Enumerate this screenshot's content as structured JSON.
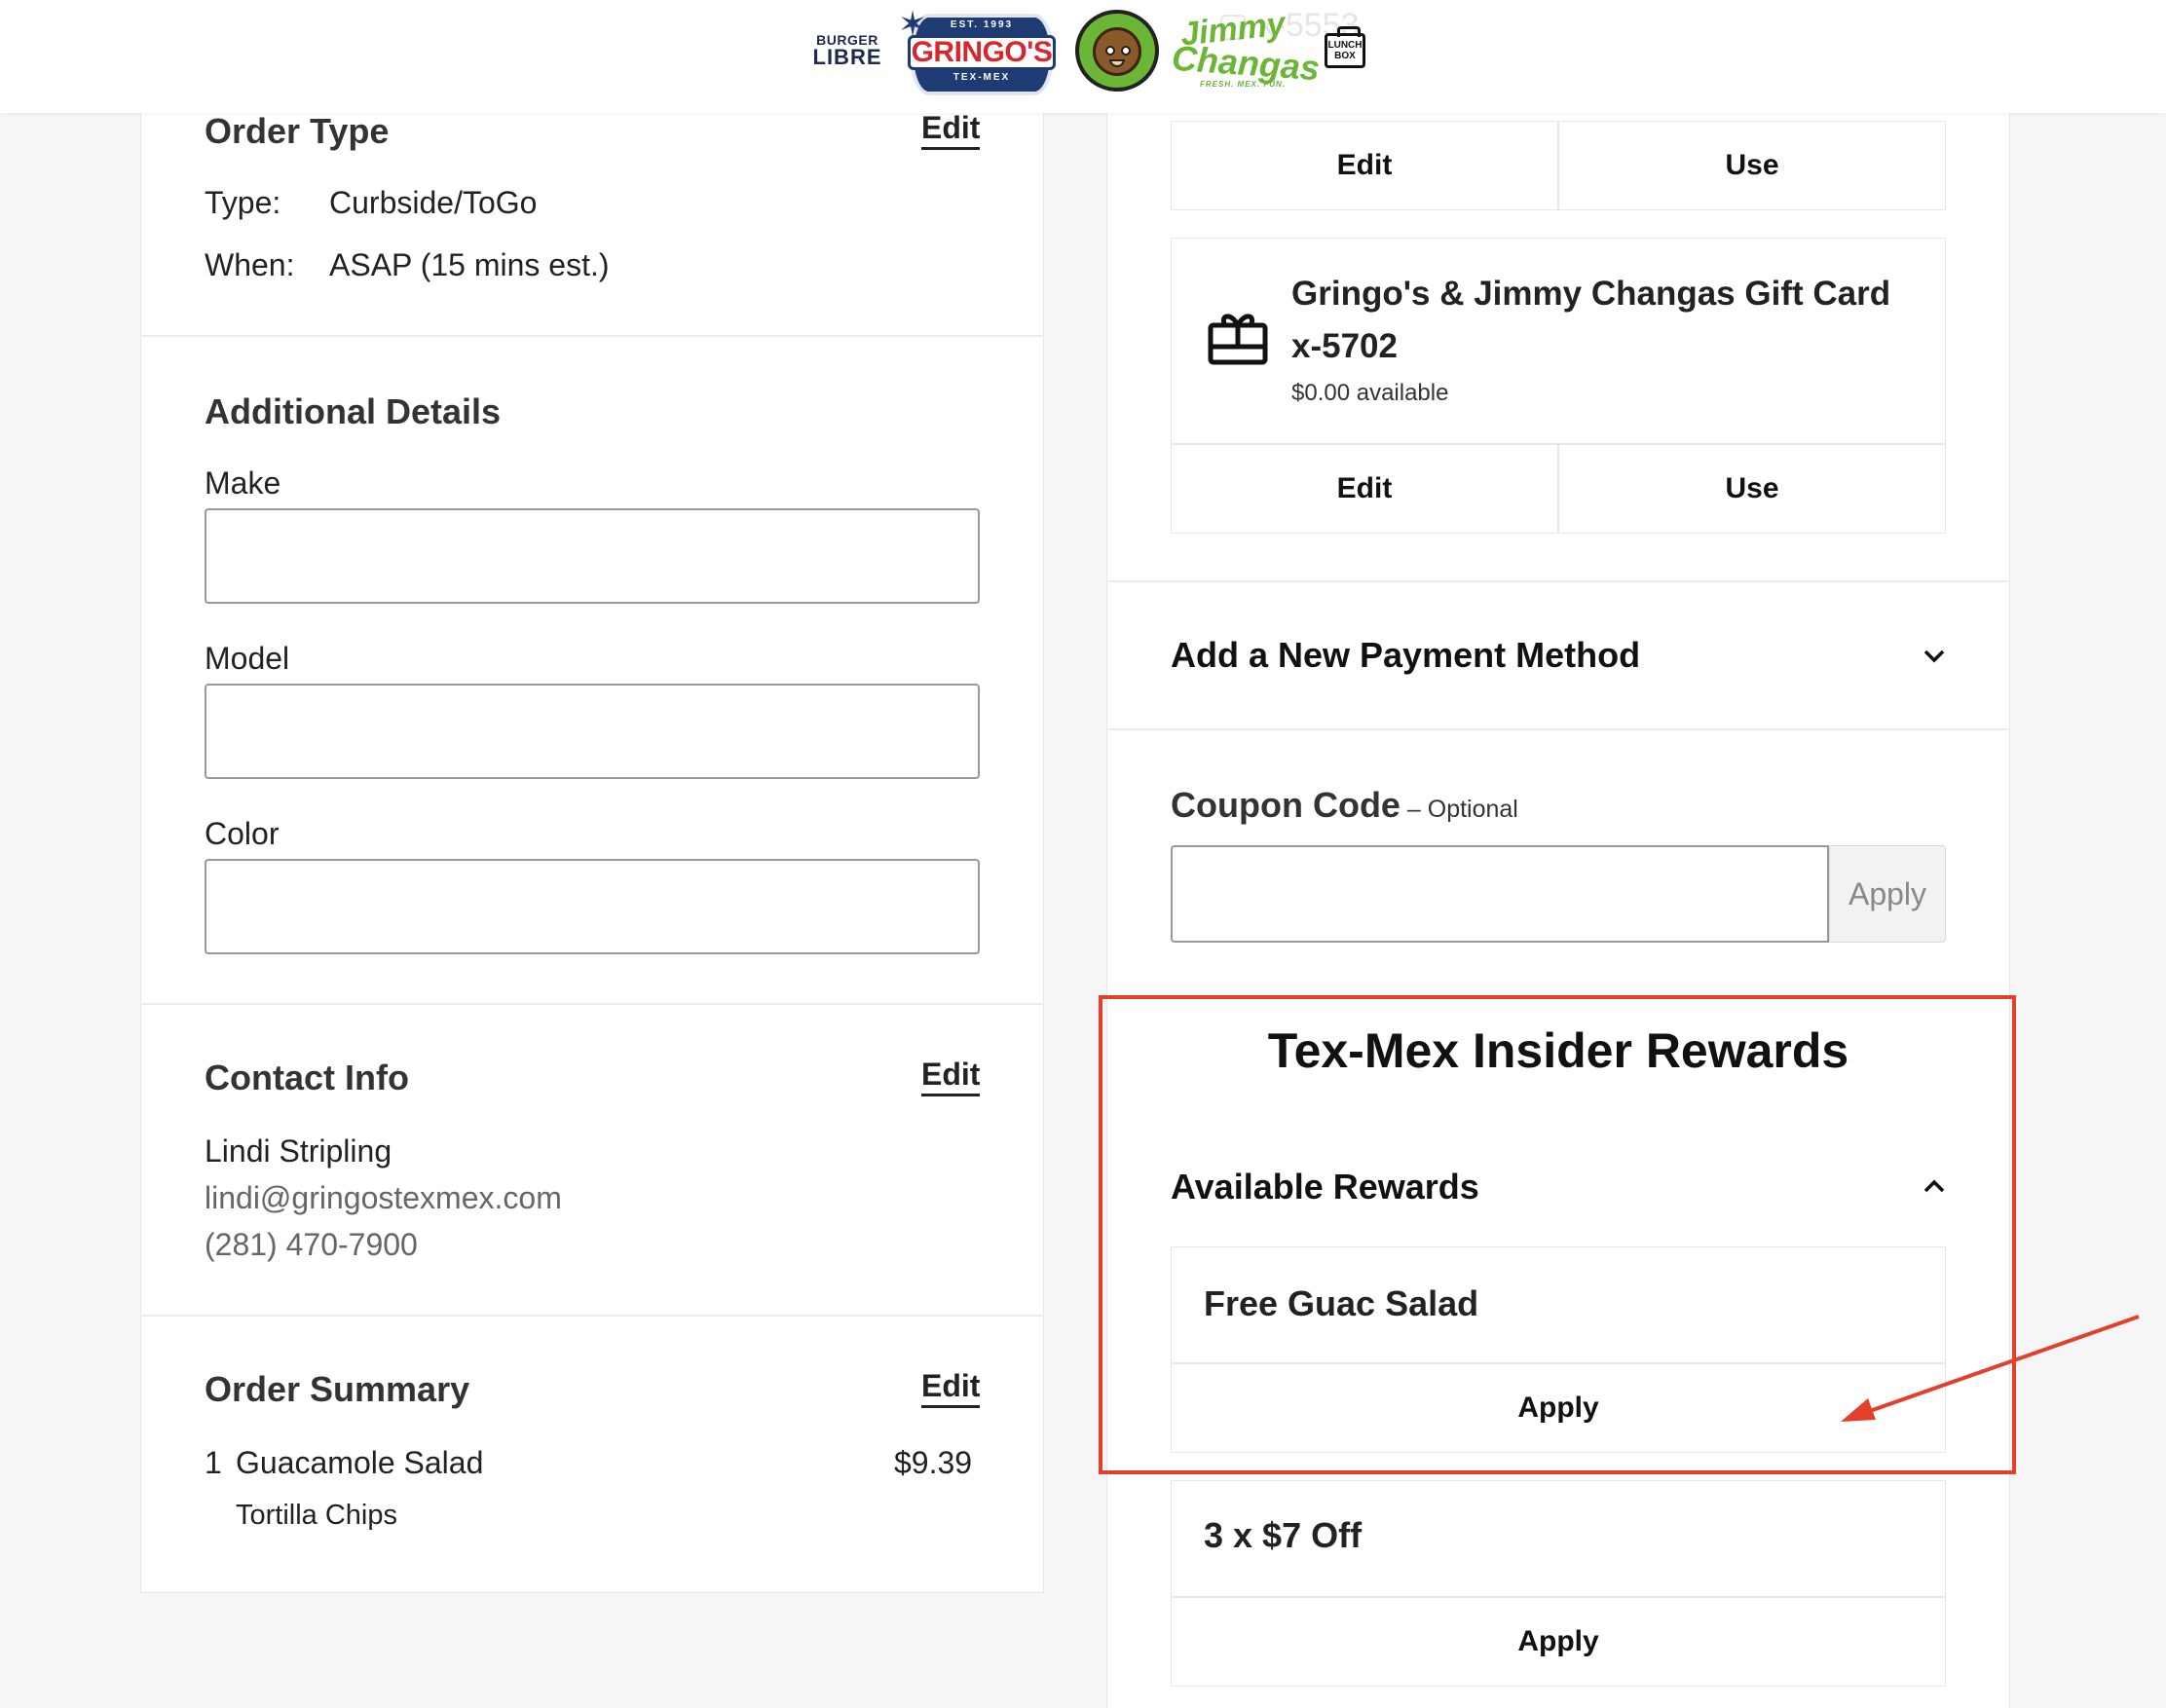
{
  "header": {
    "brands": [
      {
        "name": "burger-libre",
        "line1": "BURGER",
        "line2": "LIBRE"
      },
      {
        "name": "gringos",
        "top": "EST. 1993",
        "main": "GRINGO'S",
        "bottom": "TEX-MEX"
      },
      {
        "name": "jimmy-changas",
        "line1": "Jimmy",
        "line2": "Changas",
        "tagline": "FRESH. MEX. FUN."
      },
      {
        "name": "lunch-box",
        "line1": "LUNCH",
        "line2": "BOX"
      }
    ]
  },
  "order_type": {
    "title": "Order Type",
    "edit": "Edit",
    "type_label": "Type:",
    "type_value": "Curbside/ToGo",
    "when_label": "When:",
    "when_value": "ASAP (15 mins est.)"
  },
  "additional_details": {
    "title": "Additional Details",
    "fields": [
      {
        "label": "Make",
        "value": ""
      },
      {
        "label": "Model",
        "value": ""
      },
      {
        "label": "Color",
        "value": ""
      }
    ]
  },
  "contact_info": {
    "title": "Contact Info",
    "edit": "Edit",
    "name": "Lindi Stripling",
    "email": "lindi@gringostexmex.com",
    "phone": "(281) 470-7900"
  },
  "order_summary": {
    "title": "Order Summary",
    "edit": "Edit",
    "items": [
      {
        "qty": "1",
        "name": "Guacamole Salad",
        "price": "$9.39",
        "modifier": "Tortilla Chips"
      }
    ]
  },
  "payment": {
    "saved_cards": [
      {
        "edit": "Edit",
        "use": "Use"
      },
      {
        "title_line1": "Gringo's & Jimmy Changas Gift Card",
        "title_line2": "x-5702",
        "available": "$0.00 available",
        "edit": "Edit",
        "use": "Use"
      }
    ],
    "add_new": "Add a New Payment Method"
  },
  "coupon": {
    "title": "Coupon Code",
    "optional": " – Optional",
    "value": "",
    "apply": "Apply"
  },
  "rewards": {
    "title": "Tex-Mex Insider Rewards",
    "available_title": "Available Rewards",
    "items": [
      {
        "name": "Free Guac Salad",
        "apply": "Apply"
      },
      {
        "name": "3 x $7 Off",
        "apply": "Apply"
      }
    ]
  },
  "annotation": {
    "color": "#e2402a"
  }
}
